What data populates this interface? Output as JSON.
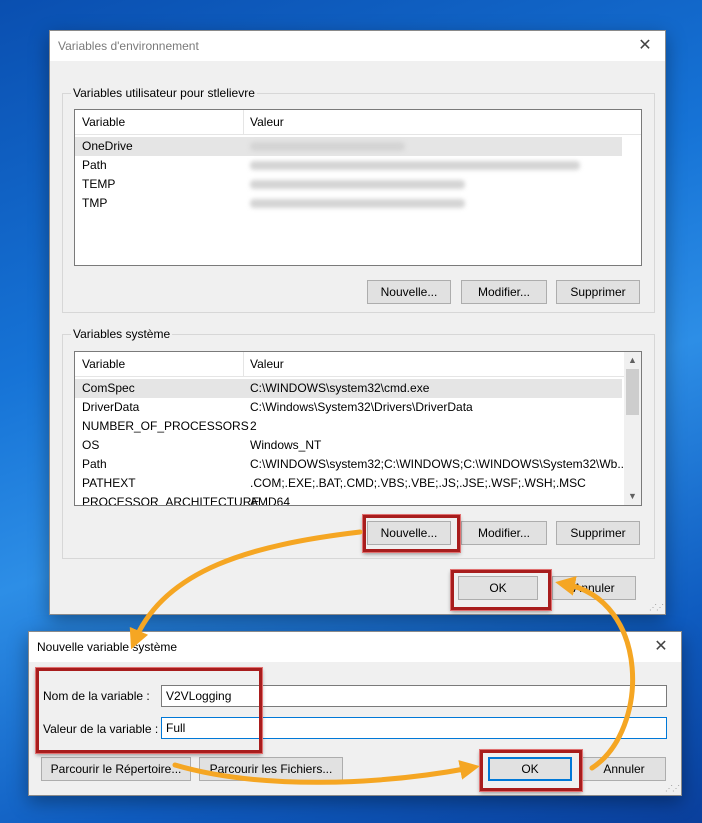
{
  "env_window": {
    "title": "Variables d'environnement",
    "user_group": {
      "label": "Variables utilisateur pour stlelievre",
      "col_variable": "Variable",
      "col_valeur": "Valeur",
      "rows": [
        {
          "name": "OneDrive"
        },
        {
          "name": "Path"
        },
        {
          "name": "TEMP"
        },
        {
          "name": "TMP"
        }
      ],
      "btn_new": "Nouvelle...",
      "btn_edit": "Modifier...",
      "btn_delete": "Supprimer"
    },
    "system_group": {
      "label": "Variables système",
      "col_variable": "Variable",
      "col_valeur": "Valeur",
      "rows": [
        {
          "name": "ComSpec",
          "value": "C:\\WINDOWS\\system32\\cmd.exe"
        },
        {
          "name": "DriverData",
          "value": "C:\\Windows\\System32\\Drivers\\DriverData"
        },
        {
          "name": "NUMBER_OF_PROCESSORS",
          "value": "2"
        },
        {
          "name": "OS",
          "value": "Windows_NT"
        },
        {
          "name": "Path",
          "value": "C:\\WINDOWS\\system32;C:\\WINDOWS;C:\\WINDOWS\\System32\\Wb..."
        },
        {
          "name": "PATHEXT",
          "value": ".COM;.EXE;.BAT;.CMD;.VBS;.VBE;.JS;.JSE;.WSF;.WSH;.MSC"
        },
        {
          "name": "PROCESSOR_ARCHITECTURE",
          "value": "AMD64"
        }
      ],
      "btn_new": "Nouvelle...",
      "btn_edit": "Modifier...",
      "btn_delete": "Supprimer"
    },
    "btn_ok": "OK",
    "btn_cancel": "Annuler"
  },
  "new_var_dialog": {
    "title": "Nouvelle variable système",
    "name_label": "Nom de la variable :",
    "name_value": "V2VLogging",
    "value_label": "Valeur de la variable :",
    "value_value": "Full",
    "btn_browse_dir": "Parcourir le Répertoire...",
    "btn_browse_files": "Parcourir les Fichiers...",
    "btn_ok": "OK",
    "btn_cancel": "Annuler"
  },
  "annotation_color": "#a81d1d",
  "arrow_color": "#f5a623"
}
